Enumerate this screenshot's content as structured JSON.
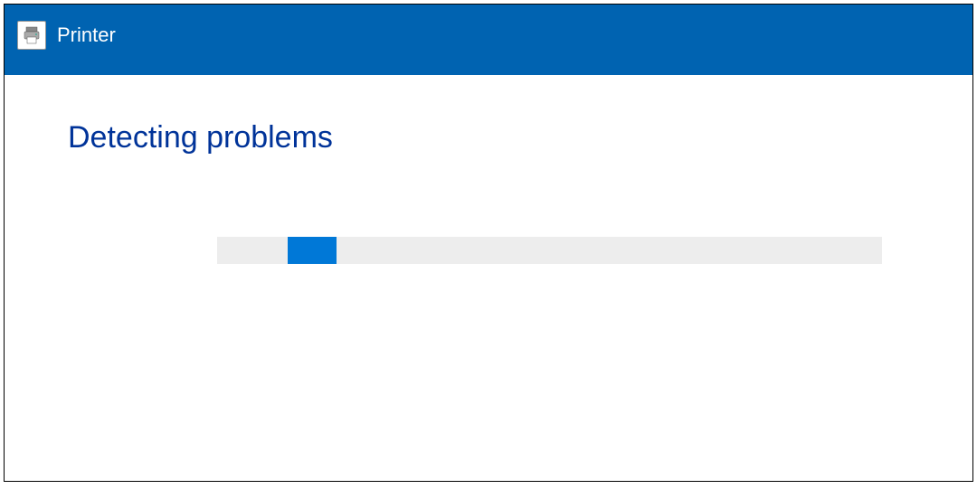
{
  "title_bar": {
    "title": "Printer",
    "icon_name": "printer-icon"
  },
  "main": {
    "heading": "Detecting problems"
  },
  "progress": {
    "track_color": "#EDEDED",
    "indicator_color": "#0078D7"
  },
  "colors": {
    "title_bar_bg": "#0063B1",
    "heading_color": "#003399"
  }
}
